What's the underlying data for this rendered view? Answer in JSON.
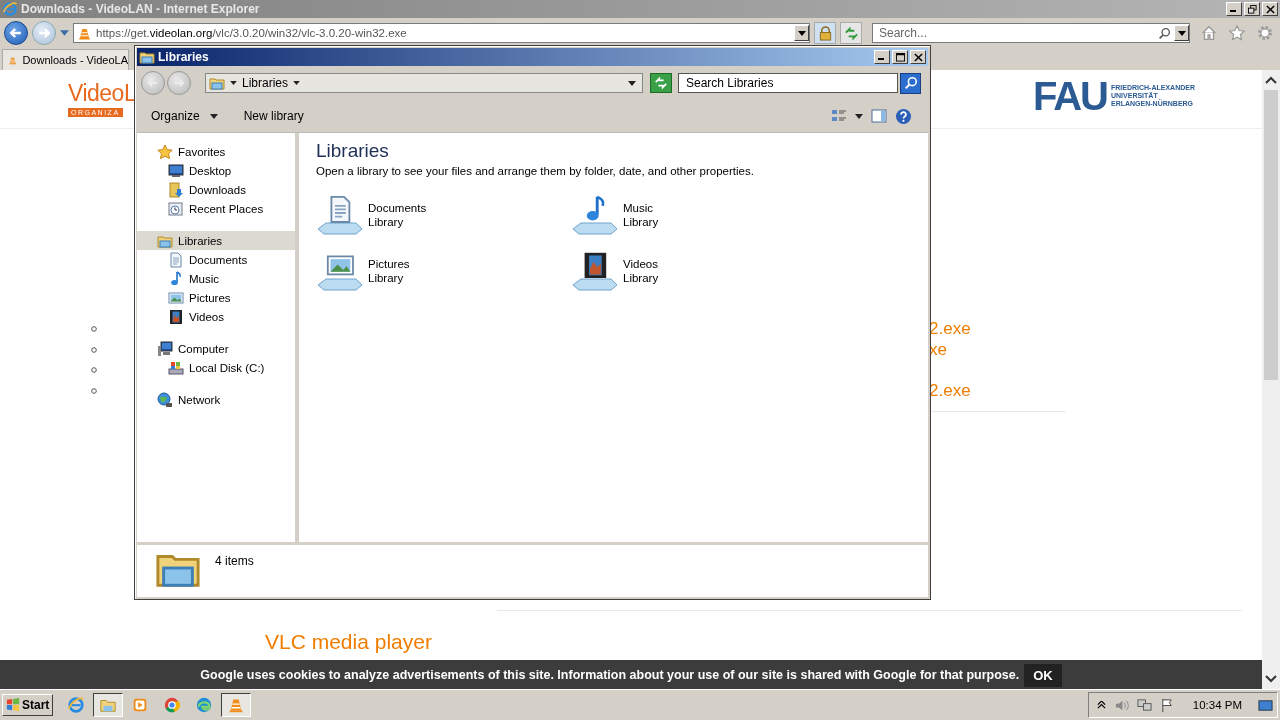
{
  "browser": {
    "title": "Downloads - VideoLAN - Internet Explorer",
    "address": {
      "scheme": "https://",
      "host_prefix": "get.",
      "host": "videolan.org",
      "path": "/vlc/3.0.20/win32/vlc-3.0.20-win32.exe"
    },
    "search": {
      "placeholder": "Search..."
    },
    "tab": {
      "label": "Downloads - VideoLA"
    }
  },
  "page": {
    "logo": {
      "name": "VideoL",
      "subtitle": "ORGANIZA"
    },
    "partner_logo": {
      "letters": "FAU",
      "lines": [
        "FRIEDRICH-ALEXANDER",
        "UNIVERSITÄT",
        "ERLANGEN-NÜRNBERG"
      ]
    },
    "list": [
      {
        "kind": "link",
        "text": "2.exe"
      },
      {
        "kind": "link",
        "text": "xe"
      },
      {
        "kind": "blank"
      },
      {
        "kind": "link",
        "text": "2.exe"
      }
    ],
    "heading": "VLC media player"
  },
  "explorer": {
    "title": "Libraries",
    "breadcrumb": "Libraries",
    "search": {
      "placeholder": "Search Libraries"
    },
    "toolbar": [
      {
        "label": "Organize",
        "dropdown": true
      },
      {
        "label": "New library",
        "dropdown": false
      }
    ],
    "nav": [
      {
        "label": "Favorites",
        "kind": "star",
        "selected": false,
        "children": [
          {
            "label": "Desktop",
            "kind": "desktop",
            "selected": false
          },
          {
            "label": "Downloads",
            "kind": "downloads",
            "selected": false
          },
          {
            "label": "Recent Places",
            "kind": "recent",
            "selected": false
          }
        ]
      },
      {
        "label": "Libraries",
        "kind": "libraries",
        "selected": true,
        "children": [
          {
            "label": "Documents",
            "kind": "documents",
            "selected": false
          },
          {
            "label": "Music",
            "kind": "music",
            "selected": false
          },
          {
            "label": "Pictures",
            "kind": "pictures",
            "selected": false
          },
          {
            "label": "Videos",
            "kind": "videos",
            "selected": false
          }
        ]
      },
      {
        "label": "Computer",
        "kind": "computer",
        "selected": false,
        "children": [
          {
            "label": "Local Disk (C:)",
            "kind": "disk",
            "selected": false
          }
        ]
      },
      {
        "label": "Network",
        "kind": "network",
        "selected": false
      }
    ],
    "heading": "Libraries",
    "description": "Open a library to see your files and arrange them by folder, date, and other properties.",
    "libraries": [
      {
        "name": "Documents",
        "sub": "Library",
        "kind": "documents"
      },
      {
        "name": "Music",
        "sub": "Library",
        "kind": "music"
      },
      {
        "name": "Pictures",
        "sub": "Library",
        "kind": "pictures"
      },
      {
        "name": "Videos",
        "sub": "Library",
        "kind": "videos"
      }
    ],
    "status": "4 items"
  },
  "cookie_bar": {
    "text": "Google uses cookies to analyze advertisements of this site. Information about your use of our site is shared with Google for that purpose.",
    "button": "OK"
  },
  "taskbar": {
    "start": "Start",
    "apps": [
      {
        "kind": "ie",
        "selected": false
      },
      {
        "kind": "explorer",
        "selected": true
      },
      {
        "kind": "media",
        "selected": false
      },
      {
        "kind": "chrome",
        "selected": false
      },
      {
        "kind": "edge",
        "selected": false
      },
      {
        "kind": "vlc",
        "selected": true
      }
    ],
    "clock": "10:34 PM"
  }
}
